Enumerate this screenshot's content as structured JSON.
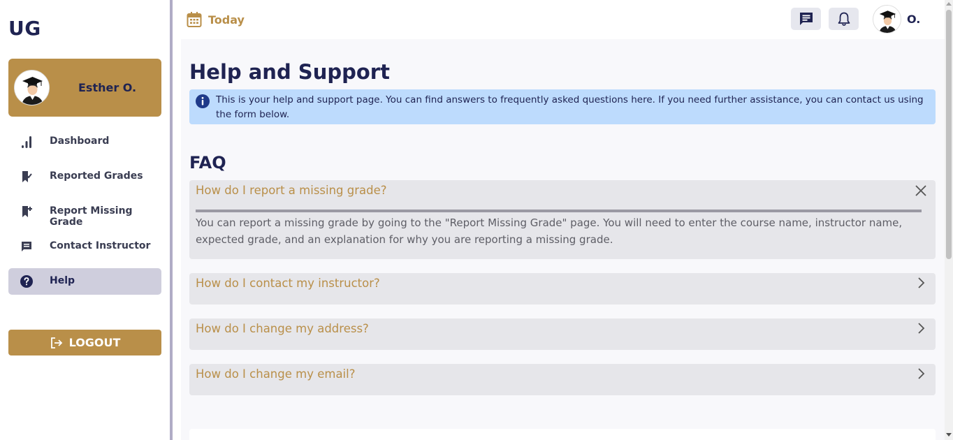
{
  "app": {
    "logo": "UG"
  },
  "profile": {
    "name": "Esther O."
  },
  "sidebar": {
    "items": [
      {
        "label": "Dashboard",
        "icon": "bar-chart-icon"
      },
      {
        "label": "Reported Grades",
        "icon": "bookmark-check-icon"
      },
      {
        "label": "Report Missing Grade",
        "icon": "bookmark-add-icon"
      },
      {
        "label": "Contact Instructor",
        "icon": "message-icon"
      },
      {
        "label": "Help",
        "icon": "help-circle-icon",
        "active": true
      }
    ],
    "logout_label": "LOGOUT"
  },
  "topbar": {
    "today_label": "Today",
    "user_initial": "O."
  },
  "main": {
    "title": "Help and Support",
    "info_text": "This is your help and support page. You can find answers to frequently asked questions here. If you need further assistance, you can contact us using the form below.",
    "faq_title": "FAQ",
    "faqs": [
      {
        "question": "How do I report a missing grade?",
        "answer": "You can report a missing grade by going to the \"Report Missing Grade\" page. You will need to enter the course name, instructor name, expected grade, and an explanation for why you are reporting a missing grade.",
        "expanded": true
      },
      {
        "question": "How do I contact my instructor?",
        "expanded": false
      },
      {
        "question": "How do I change my address?",
        "expanded": false
      },
      {
        "question": "How do I change my email?",
        "expanded": false
      }
    ]
  },
  "colors": {
    "navy": "#1f2352",
    "gold": "#b98f49",
    "info_bg": "#bddbfd",
    "active_nav": "#cfcedd",
    "faq_bg": "#e6e6ea"
  }
}
